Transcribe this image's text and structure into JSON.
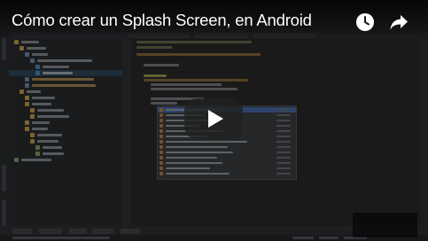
{
  "video": {
    "title": "Cómo crear un Splash Screen, en Android",
    "icons": {
      "watch_later": "clock-icon",
      "share": "share-arrow-icon",
      "play": "play-icon"
    }
  },
  "colors": {
    "overlay_text": "#ffffff",
    "play_button_bg": "#212121",
    "ide_background": "#2b2b2b",
    "selection_blue": "#4b6eaf",
    "project_selection": "#2f4a5c"
  }
}
